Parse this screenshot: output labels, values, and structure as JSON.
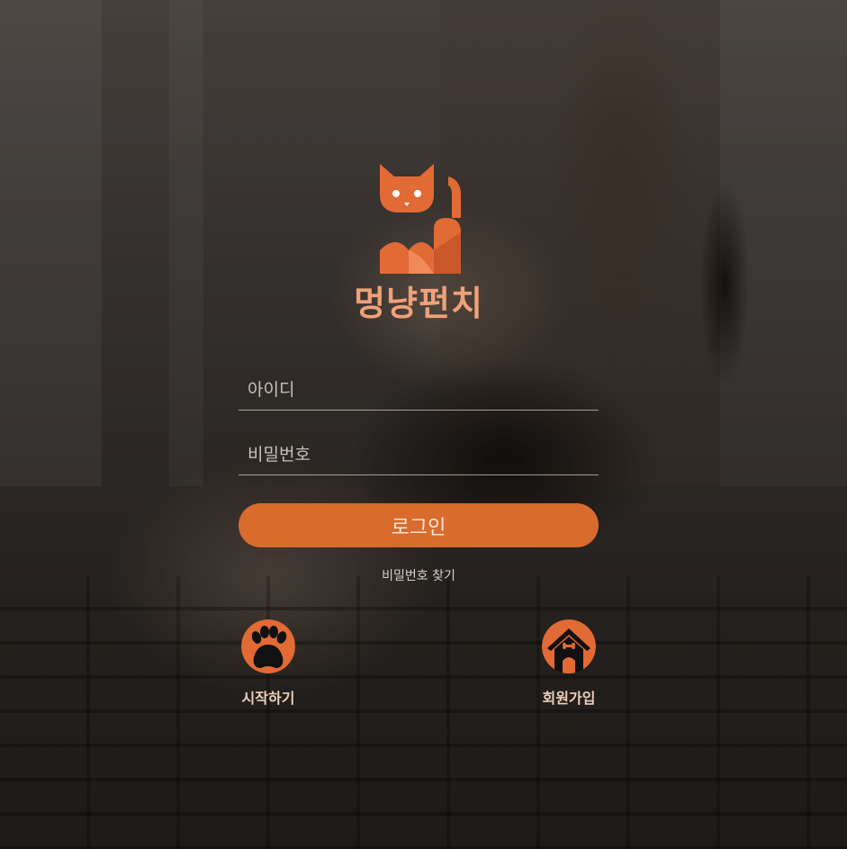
{
  "brand": {
    "name": "멍냥펀치"
  },
  "login_form": {
    "id_placeholder": "아이디",
    "password_placeholder": "비밀번호",
    "login_button": "로그인",
    "find_password": "비밀번호 찾기"
  },
  "actions": [
    {
      "label": "시작하기",
      "icon": "paw-icon"
    },
    {
      "label": "회원가입",
      "icon": "dog-house-icon"
    }
  ],
  "colors": {
    "accent": "#d96b2c",
    "brand_text": "#f0a17a",
    "action_label": "#efcfb9"
  }
}
